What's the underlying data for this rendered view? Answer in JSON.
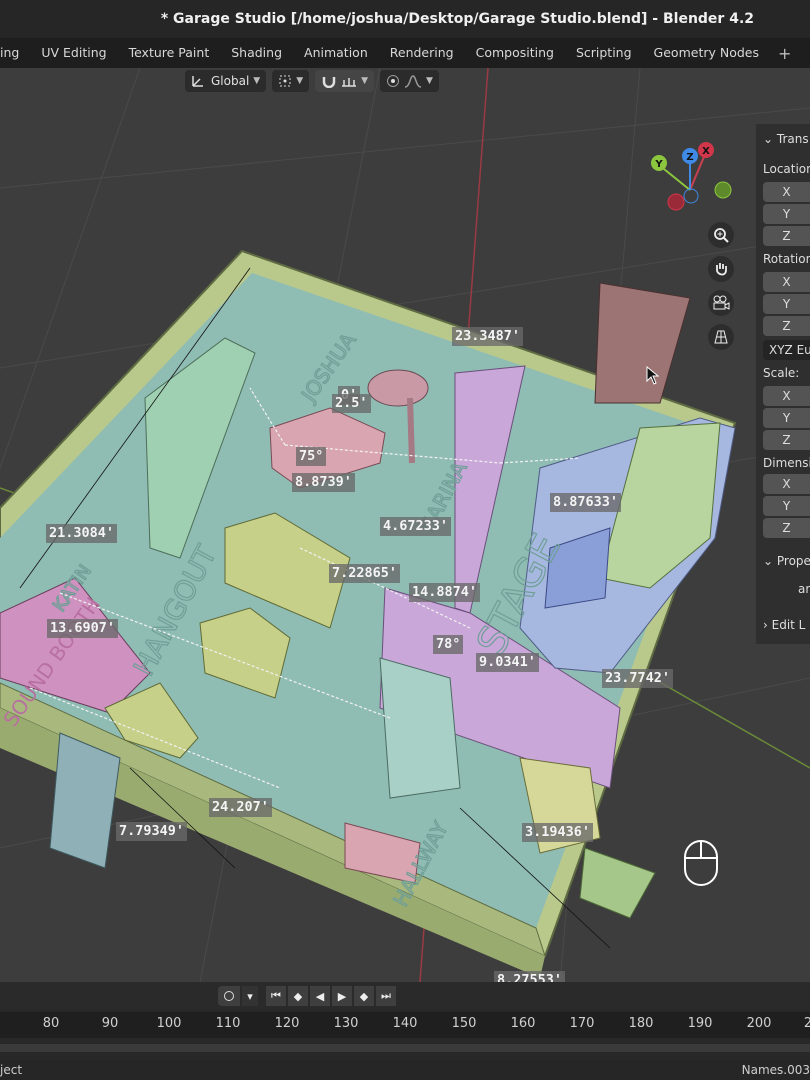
{
  "window": {
    "title": "* Garage Studio [/home/joshua/Desktop/Garage Studio.blend] - Blender 4.2"
  },
  "workspace_tabs": [
    "ing",
    "UV Editing",
    "Texture Paint",
    "Shading",
    "Animation",
    "Rendering",
    "Compositing",
    "Scripting",
    "Geometry Nodes"
  ],
  "add_tab_label": "+",
  "viewport": {
    "transform_orientation": "Global",
    "gizmo_axes": {
      "x": "X",
      "y": "Y",
      "z": "Z"
    },
    "axis_colors": {
      "x": "#d2364a",
      "y": "#8cc63f",
      "z": "#3f8ae6"
    },
    "floor_labels": [
      "JOSHUA",
      "SARINA",
      "STAGE",
      "HANGOUT",
      "KATIN",
      "SOUND BOOTH",
      "HALLWAY"
    ],
    "dimension_labels": [
      "23.3487'",
      "0'",
      "2.5'",
      "75°",
      "8.8739'",
      "4.67233'",
      "8.87633'",
      "21.3084'",
      "7.22865'",
      "14.8874'",
      "13.6907'",
      "78°",
      "9.0341'",
      "23.7742'",
      "24.207'",
      "7.79349'",
      "3.19436'",
      "8.27553'"
    ],
    "nav_icons": [
      "zoom-icon",
      "hand-icon",
      "camera-icon",
      "grid-icon"
    ]
  },
  "sidebar": {
    "transform_header": "Trans",
    "location_label": "Location",
    "rotation_label": "Rotation",
    "rotation_mode": "XYZ Eu",
    "scale_label": "Scale:",
    "dimensions_label": "Dimensi",
    "properties_header": "Prope",
    "properties_value": "ar",
    "edit_header": "Edit L",
    "axes": [
      "X",
      "Y",
      "Z"
    ]
  },
  "timeline": {
    "frame_ticks": [
      "80",
      "90",
      "100",
      "110",
      "120",
      "130",
      "140",
      "150",
      "160",
      "170",
      "180",
      "190",
      "200",
      "2"
    ]
  },
  "statusbar": {
    "left_text": "ject",
    "right_text": "Names.003"
  }
}
